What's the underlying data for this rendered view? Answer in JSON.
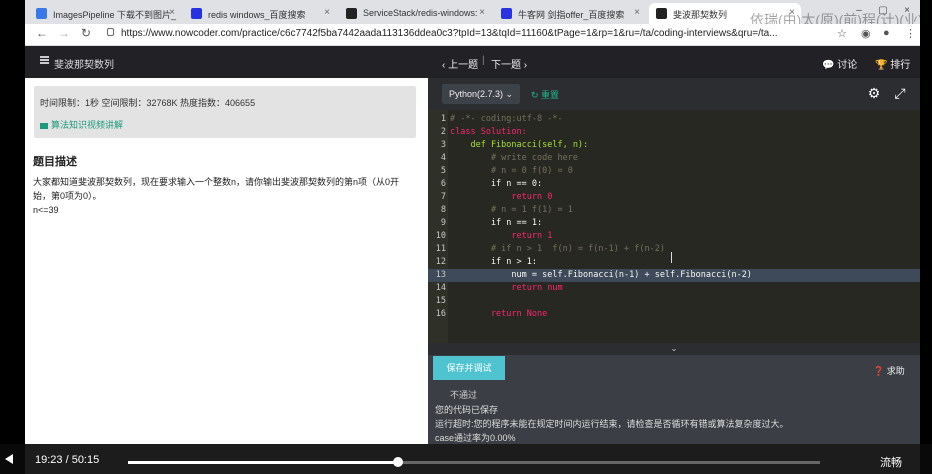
{
  "browser": {
    "tabs": [
      {
        "label": "ImagesPipeline 下载不到图片_",
        "active": false,
        "favicon_color": "#3b78e7"
      },
      {
        "label": "redis windows_百度搜索",
        "active": false,
        "favicon_color": "#2932e1"
      },
      {
        "label": "ServiceStack/redis-windows:",
        "active": false,
        "favicon_color": "#222222"
      },
      {
        "label": "牛客网 剑指offer_百度搜索",
        "active": false,
        "favicon_color": "#2932e1"
      },
      {
        "label": "斐波那契数列",
        "active": true,
        "favicon_color": "#222222"
      }
    ],
    "url": "https://www.nowcoder.com/practice/c6c7742f5ba7442aada113136ddea0c3?tpId=13&tqId=11160&tPage=1&rp=1&ru=/ta/coding-interviews&qru=/ta...",
    "watermark": "依瑞(由)太(原)(前)程(计)(业)(山)"
  },
  "header": {
    "title": "斐波那契数列",
    "prev": "上一题",
    "next": "下一题",
    "discuss": "讨论",
    "rank": "排行"
  },
  "problem": {
    "limits": "时间限制：1秒    空间限制：32768K    热度指数：406655",
    "video_link": "算法知识视频讲解",
    "desc_title": "题目描述",
    "desc_line1": "大家都知道斐波那契数列，现在要求输入一个整数n，请你输出斐波那契数列的第n项（从0开",
    "desc_line2": "始，第0项为0）。",
    "desc_line3": "n<=39"
  },
  "editor": {
    "language": "Python(2.7.3)",
    "reset": "重置",
    "lines": [
      {
        "n": "1",
        "text": "# -*- coding:utf-8 -*-"
      },
      {
        "n": "2",
        "text": "class Solution:"
      },
      {
        "n": "3",
        "text": "    def Fibonacci(self, n):"
      },
      {
        "n": "4",
        "text": "        # write code here"
      },
      {
        "n": "5",
        "text": "        # n = 0 f(0) = 0"
      },
      {
        "n": "6",
        "text": "        if n == 0:"
      },
      {
        "n": "7",
        "text": "            return 0"
      },
      {
        "n": "8",
        "text": "        # n = 1 f(1) = 1"
      },
      {
        "n": "9",
        "text": "        if n == 1:"
      },
      {
        "n": "10",
        "text": "            return 1"
      },
      {
        "n": "11",
        "text": "        # if n > 1  f(n) = f(n-1) + f(n-2)"
      },
      {
        "n": "12",
        "text": "        if n > 1:"
      },
      {
        "n": "13",
        "text": "            num = self.Fibonacci(n-1) + self.Fibonacci(n-2)"
      },
      {
        "n": "14",
        "text": "            return num"
      },
      {
        "n": "15",
        "text": "        "
      },
      {
        "n": "16",
        "text": "        return None"
      }
    ]
  },
  "result": {
    "save_button": "保存并调试",
    "help": "求助",
    "status": "不通过",
    "saved": "您的代码已保存",
    "error": "运行超时:您的程序未能在规定时间内运行结束，请检查是否循环有错或算法复杂度过大。",
    "pass_rate": "case通过率为0.00%"
  },
  "player": {
    "time": "19:23 / 50:15",
    "progress": 0.39,
    "quality": "流畅"
  }
}
